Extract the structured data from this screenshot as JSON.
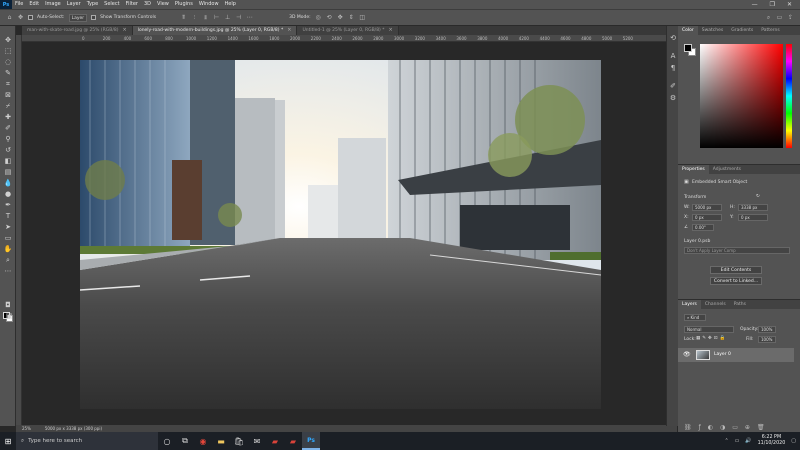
{
  "menubar": {
    "logo": "Ps",
    "items": [
      "File",
      "Edit",
      "Image",
      "Layer",
      "Type",
      "Select",
      "Filter",
      "3D",
      "View",
      "Plugins",
      "Window",
      "Help"
    ],
    "window_controls": [
      "—",
      "❐",
      "✕"
    ]
  },
  "options": {
    "auto_select_label": "Auto-Select:",
    "auto_select_value": "Layer",
    "transform_label": "Show Transform Controls",
    "mode_3d": "3D Mode:"
  },
  "tabs": [
    {
      "label": "man-with-skate-road.jpg @ 25% (RGB/8)",
      "active": false
    },
    {
      "label": "lonely-road-with-modern-buildings.jpg @ 25% (Layer 0, RGB/8) *",
      "active": true
    },
    {
      "label": "Untitled-1 @ 25% (Layer 0, RGB/8) *",
      "active": false
    }
  ],
  "ruler_ticks": [
    "0",
    "200",
    "400",
    "600",
    "800",
    "1000",
    "1200",
    "1400",
    "1600",
    "1800",
    "2000",
    "2200",
    "2400",
    "2600",
    "2800",
    "3000",
    "3200",
    "3400",
    "3600",
    "3800",
    "4000",
    "4200",
    "4400",
    "4600",
    "4800",
    "5000",
    "5200"
  ],
  "status": {
    "zoom": "25%",
    "doc_size": "5000 px x 3338 px (300 ppi)"
  },
  "color_panel": {
    "tabs": [
      "Color",
      "Swatches",
      "Gradients",
      "Patterns"
    ]
  },
  "properties_panel": {
    "tabs": [
      "Properties",
      "Adjustments"
    ],
    "object_type": "Embedded Smart Object",
    "transform_label": "Transform",
    "w_label": "W:",
    "w_value": "5000 px",
    "h_label": "H:",
    "h_value": "3338 px",
    "x_label": "X:",
    "x_value": "0 px",
    "y_label": "Y:",
    "y_value": "0 px",
    "angle_value": "0.00°",
    "layer_comp_label": "Layer 0.psb",
    "layer_comp_value": "Don't Apply Layer Comp",
    "edit_contents": "Edit Contents",
    "convert_to_linked": "Convert to Linked..."
  },
  "layers_panel": {
    "tabs": [
      "Layers",
      "Channels",
      "Paths"
    ],
    "kind_label": "Kind",
    "blend_mode": "Normal",
    "opacity_label": "Opacity:",
    "opacity_value": "100%",
    "lock_label": "Lock:",
    "fill_label": "Fill:",
    "fill_value": "100%",
    "layer_name": "Layer 0"
  },
  "taskbar": {
    "search_placeholder": "Type here to search",
    "time": "6:22 PM",
    "date": "11/10/2020"
  },
  "colors": {
    "accent": "#31a8ff",
    "panel_bg": "#535353",
    "canvas_bg": "#282828"
  }
}
